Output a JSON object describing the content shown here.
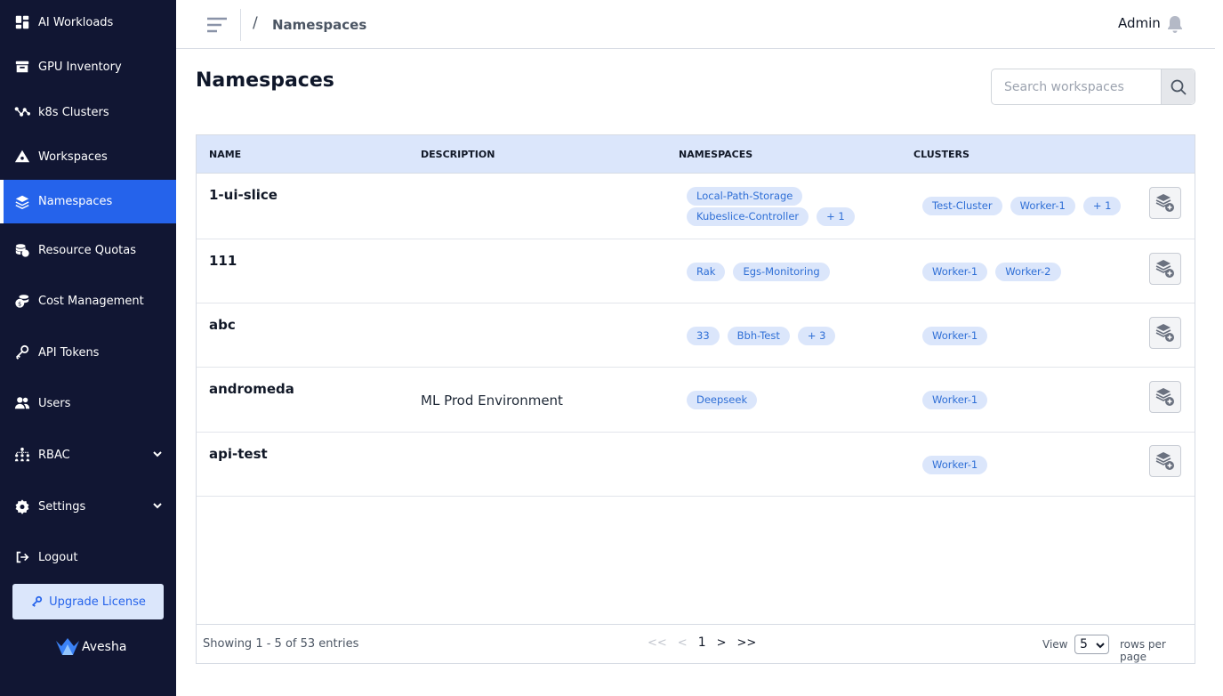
{
  "sidebar": {
    "items": [
      {
        "label": "AI Workloads",
        "icon": "dashboard-icon"
      },
      {
        "label": "GPU Inventory",
        "icon": "archive-icon"
      },
      {
        "label": "k8s Clusters",
        "icon": "cluster-nodes-icon"
      },
      {
        "label": "Workspaces",
        "icon": "workspace-icon"
      },
      {
        "label": "Namespaces",
        "icon": "layers-icon",
        "active": true
      },
      {
        "label": "Resource Quotas",
        "icon": "coins-icon"
      },
      {
        "label": "Cost Management",
        "icon": "money-icon"
      },
      {
        "label": "API Tokens",
        "icon": "key-icon"
      },
      {
        "label": "Users",
        "icon": "users-icon"
      },
      {
        "label": "RBAC",
        "icon": "hierarchy-icon"
      },
      {
        "label": "Settings",
        "icon": "gear-icon"
      },
      {
        "label": "Logout",
        "icon": "logout-icon"
      }
    ],
    "upgrade_label": "Upgrade License",
    "brand": "Avesha"
  },
  "topbar": {
    "breadcrumb_sep": "/",
    "breadcrumb": "Namespaces",
    "user": "Admin"
  },
  "page": {
    "title": "Namespaces",
    "search_placeholder": "Search workspaces"
  },
  "table": {
    "headers": {
      "name": "NAME",
      "description": "DESCRIPTION",
      "namespaces": "NAMESPACES",
      "clusters": "CLUSTERS"
    },
    "rows": [
      {
        "name": "1-ui-slice",
        "description": "",
        "ns1": "Local-Path-Storage",
        "ns2": "Kubeslice-Controller",
        "ns_more": "+ 1",
        "c1": "Test-Cluster",
        "c2": "Worker-1",
        "c_more": "+ 1"
      },
      {
        "name": "111",
        "description": "",
        "ns1": "Rak",
        "ns2": "Egs-Monitoring",
        "c1": "Worker-1",
        "c2": "Worker-2"
      },
      {
        "name": "abc",
        "description": "",
        "ns1": "33",
        "ns2": "Bbh-Test",
        "ns_more": "+ 3",
        "c1": "Worker-1"
      },
      {
        "name": "andromeda",
        "description": "ML Prod Environment",
        "ns1": "Deepseek",
        "c1": "Worker-1"
      },
      {
        "name": "api-test",
        "description": "",
        "c1": "Worker-1"
      }
    ]
  },
  "footer": {
    "showing": "Showing 1 - 5 of 53 entries",
    "first": "<<",
    "prev": "<",
    "page": "1",
    "next": ">",
    "last": ">>",
    "view_label": "View",
    "rows_per_page_value": "5",
    "rows_per_page_label": "rows per page"
  },
  "colors": {
    "sidebar_bg": "#111633",
    "accent": "#2563eb",
    "chip_bg": "#dbe6fb",
    "chip_text": "#2f6fd6",
    "header_bg": "#dbe6fb"
  }
}
